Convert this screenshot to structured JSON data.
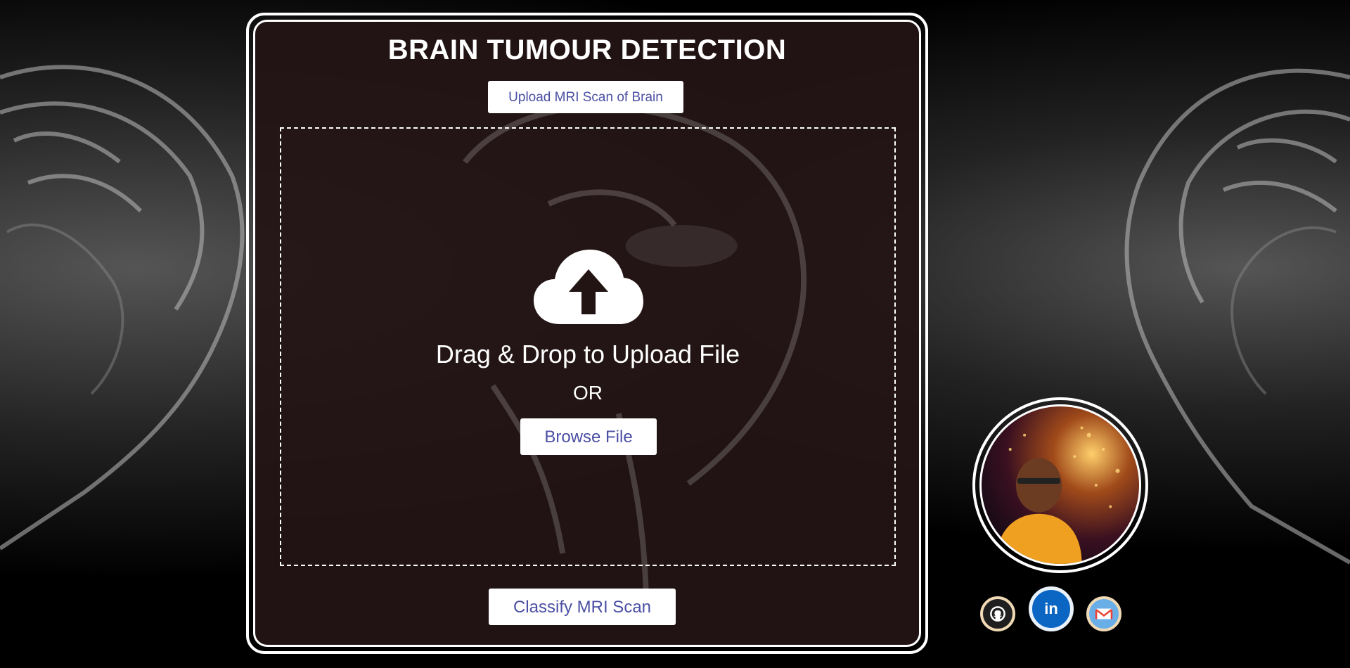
{
  "header": {
    "title": "BRAIN TUMOUR DETECTION"
  },
  "upload": {
    "button_label": "Upload MRI Scan of Brain"
  },
  "dropzone": {
    "icon": "cloud-upload-icon",
    "drag_text": "Drag & Drop to Upload File",
    "or_text": "OR",
    "browse_label": "Browse File"
  },
  "actions": {
    "classify_label": "Classify MRI Scan"
  },
  "profile": {
    "avatar_icon": "profile-avatar",
    "socials": [
      {
        "icon": "github-icon"
      },
      {
        "icon": "linkedin-icon",
        "text": "in"
      },
      {
        "icon": "gmail-icon"
      }
    ]
  },
  "colors": {
    "panel": "#231414",
    "button_text": "#4b4fa3",
    "button_bg": "#ffffff",
    "linkedin": "#0a66c2"
  }
}
